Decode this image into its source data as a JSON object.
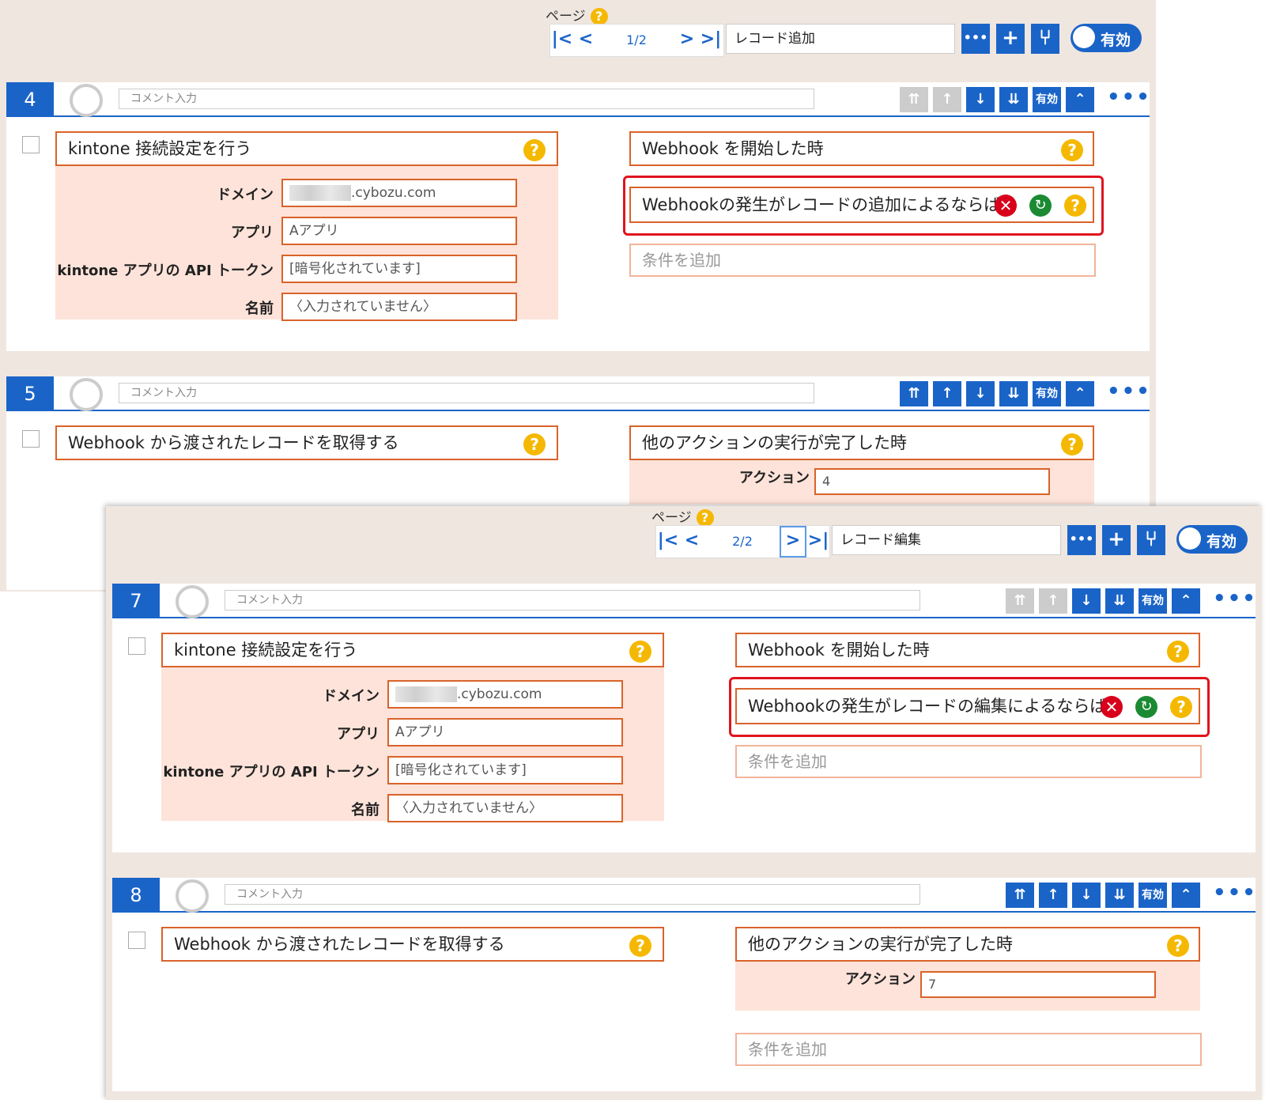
{
  "views": [
    {
      "toolbar": {
        "page_label": "ページ",
        "help": "?",
        "first": "|<",
        "prev": "<",
        "page": "1/2",
        "next": ">",
        "last": ">|",
        "event_select": "レコード追加",
        "more": "•••",
        "add": "+",
        "flow": "⑂",
        "toggle": "有効"
      },
      "cards": [
        {
          "number": "4",
          "comment_placeholder": "コメント入力",
          "enabled_label": "有効",
          "action_title": "kintone 接続設定を行う",
          "params": [
            {
              "label": "ドメイン",
              "value": ".cybozu.com"
            },
            {
              "label": "アプリ",
              "value": "Aアプリ"
            },
            {
              "label": "kintone アプリの API トークン",
              "value": "[暗号化されています]"
            },
            {
              "label": "名前",
              "value": "〈入力されていません〉"
            }
          ],
          "trigger_title": "Webhook を開始した時",
          "condition": "Webhookの発生がレコードの追加によるならば",
          "add_condition": "条件を追加"
        },
        {
          "number": "5",
          "comment_placeholder": "コメント入力",
          "enabled_label": "有効",
          "action_title": "Webhook から渡されたレコードを取得する",
          "trigger_title": "他のアクションの実行が完了した時",
          "trigger_param_label": "アクション",
          "trigger_param_value": "4"
        }
      ]
    },
    {
      "toolbar": {
        "page_label": "ページ",
        "help": "?",
        "first": "|<",
        "prev": "<",
        "page": "2/2",
        "next": ">",
        "last": ">|",
        "event_select": "レコード編集",
        "more": "•••",
        "add": "+",
        "flow": "⑂",
        "toggle": "有効"
      },
      "cards": [
        {
          "number": "7",
          "comment_placeholder": "コメント入力",
          "enabled_label": "有効",
          "action_title": "kintone 接続設定を行う",
          "params": [
            {
              "label": "ドメイン",
              "value": ".cybozu.com"
            },
            {
              "label": "アプリ",
              "value": "Aアプリ"
            },
            {
              "label": "kintone アプリの API トークン",
              "value": "[暗号化されています]"
            },
            {
              "label": "名前",
              "value": "〈入力されていません〉"
            }
          ],
          "trigger_title": "Webhook を開始した時",
          "condition": "Webhookの発生がレコードの編集によるならば",
          "add_condition": "条件を追加"
        },
        {
          "number": "8",
          "comment_placeholder": "コメント入力",
          "enabled_label": "有効",
          "action_title": "Webhook から渡されたレコードを取得する",
          "trigger_title": "他のアクションの実行が完了した時",
          "trigger_param_label": "アクション",
          "trigger_param_value": "7",
          "add_condition": "条件を追加"
        }
      ]
    }
  ],
  "colors": {
    "accent": "#1a64c8",
    "orange_border": "#d9632a",
    "param_bg": "#fde3d9",
    "highlight_red": "#e0141e",
    "help": "#f5b800"
  }
}
